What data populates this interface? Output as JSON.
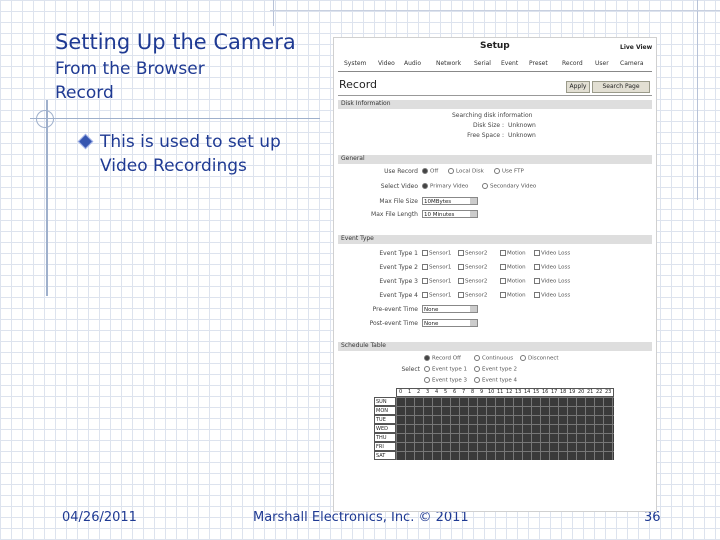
{
  "slide": {
    "title_line1": "Setting Up the Camera",
    "title_line2": "From the Browser",
    "title_line3": "Record",
    "bullet_line1": "This is used to set up",
    "bullet_line2": "Video Recordings"
  },
  "footer": {
    "date": "04/26/2011",
    "company": "Marshall Electronics, Inc. © 2011",
    "page": "36"
  },
  "screenshot": {
    "title": "Setup",
    "live_view": "Live View",
    "nav": [
      "System",
      "Video",
      "Audio",
      "Network",
      "Serial",
      "Event",
      "Preset",
      "Record",
      "User",
      "Camera"
    ],
    "heading": "Record",
    "apply_button": "Apply",
    "search_button": "Search Page",
    "disk_section": {
      "header": "Disk Information",
      "rows": [
        {
          "label": "",
          "value": "Searching disk information"
        },
        {
          "label": "Disk Size :",
          "value": "Unknown"
        },
        {
          "label": "Free Space :",
          "value": "Unknown"
        }
      ]
    },
    "general_section": {
      "header": "General",
      "use_record_label": "Use Record",
      "use_record_options": [
        "Off",
        "Local Disk",
        "Use FTP"
      ],
      "select_video_label": "Select Video",
      "select_video_options": [
        "Primary Video",
        "Secondary Video"
      ],
      "max_file_size_label": "Max File Size",
      "max_file_size_value": "10MBytes",
      "max_file_length_label": "Max File Length",
      "max_file_length_value": "10 Minutes"
    },
    "event_section": {
      "header": "Event Type",
      "rows": [
        {
          "label": "Event Type 1",
          "checks": [
            "Sensor1",
            "Sensor2",
            "Motion",
            "Video Loss"
          ]
        },
        {
          "label": "Event Type 2",
          "checks": [
            "Sensor1",
            "Sensor2",
            "Motion",
            "Video Loss"
          ]
        },
        {
          "label": "Event Type 3",
          "checks": [
            "Sensor1",
            "Sensor2",
            "Motion",
            "Video Loss"
          ]
        },
        {
          "label": "Event Type 4",
          "checks": [
            "Sensor1",
            "Sensor2",
            "Motion",
            "Video Loss"
          ]
        }
      ],
      "pre_event_label": "Pre-event Time",
      "pre_event_value": "None",
      "post_event_label": "Post-event Time",
      "post_event_value": "None"
    },
    "schedule_section": {
      "header": "Schedule Table",
      "select_label": "Select",
      "radio_row1": [
        "Record Off",
        "Continuous",
        "Disconnect"
      ],
      "radio_row2": [
        "Event type 1",
        "Event type 2"
      ],
      "radio_row3": [
        "Event type 3",
        "Event type 4"
      ],
      "hours": [
        "0",
        "1",
        "2",
        "3",
        "4",
        "5",
        "6",
        "7",
        "8",
        "9",
        "10",
        "11",
        "12",
        "13",
        "14",
        "15",
        "16",
        "17",
        "18",
        "19",
        "20",
        "21",
        "22",
        "23"
      ],
      "days": [
        "SUN",
        "MON",
        "TUE",
        "WED",
        "THU",
        "FRI",
        "SAT"
      ]
    }
  }
}
